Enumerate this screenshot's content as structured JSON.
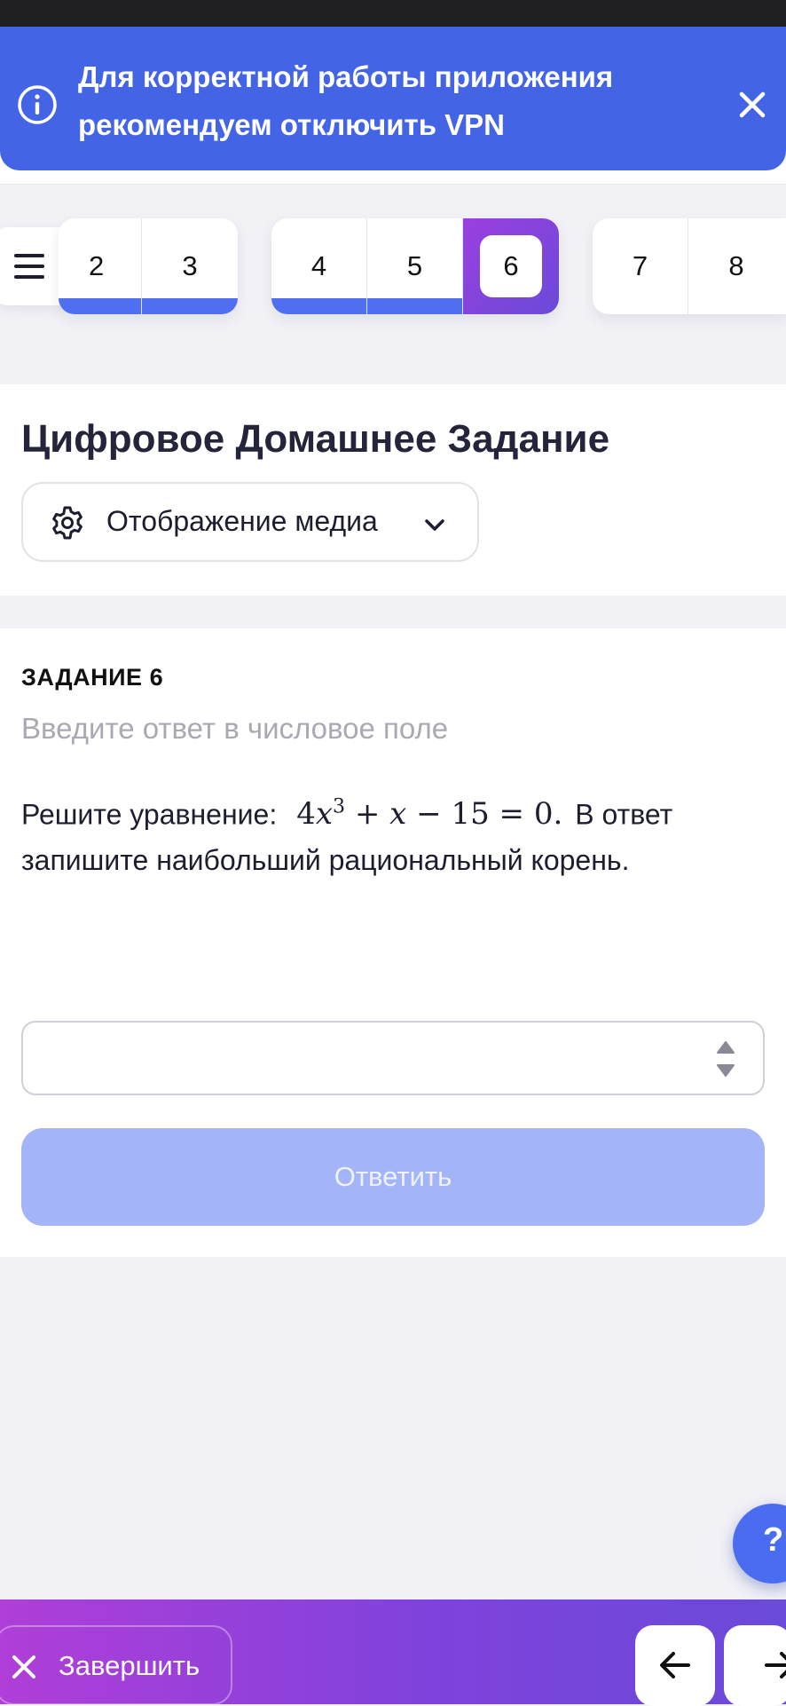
{
  "banner": {
    "text": "Для корректной работы приложения рекомендуем отключить VPN"
  },
  "question_nav": {
    "groups": [
      {
        "items": [
          {
            "label": "2",
            "done": true
          },
          {
            "label": "3",
            "done": true
          }
        ]
      },
      {
        "items": [
          {
            "label": "4",
            "done": true
          },
          {
            "label": "5",
            "done": true
          },
          {
            "label": "6",
            "active": true
          }
        ]
      },
      {
        "items": [
          {
            "label": "7"
          },
          {
            "label": "8"
          }
        ]
      }
    ]
  },
  "header": {
    "title": "Цифровое Домашнее Задание",
    "media_select_label": "Отображение медиа"
  },
  "task": {
    "label": "ЗАДАНИЕ 6",
    "hint": "Введите ответ в числовое поле",
    "text_before": "Решите уравнение:",
    "equation": {
      "coef": "4",
      "var": "x",
      "exp": "3",
      "rest_plus": "+",
      "rest_var": "x",
      "rest_tail": "− 15 = 0."
    },
    "text_after": "В ответ запишите наибольший рациональный корень.",
    "answer_value": "",
    "submit_label": "Ответить"
  },
  "help_label": "?",
  "bottom": {
    "finish_label": "Завершить"
  },
  "colors": {
    "banner": "#4464e6",
    "progress_done": "#4f6ff0",
    "active_gradient_start": "#9b3fe0",
    "active_gradient_end": "#6a4ad8",
    "submit_disabled": "#a3b4f8"
  },
  "icons": {
    "banner_info": "info-circle-icon",
    "banner_close": "close-icon",
    "menu": "hamburger-menu-icon",
    "media_settings": "gear-icon",
    "media_dropdown": "chevron-down-icon",
    "answer_stepper": "stepper-arrows-icon",
    "finish": "close-icon",
    "prev": "arrow-left-icon",
    "next": "arrow-right-icon"
  }
}
